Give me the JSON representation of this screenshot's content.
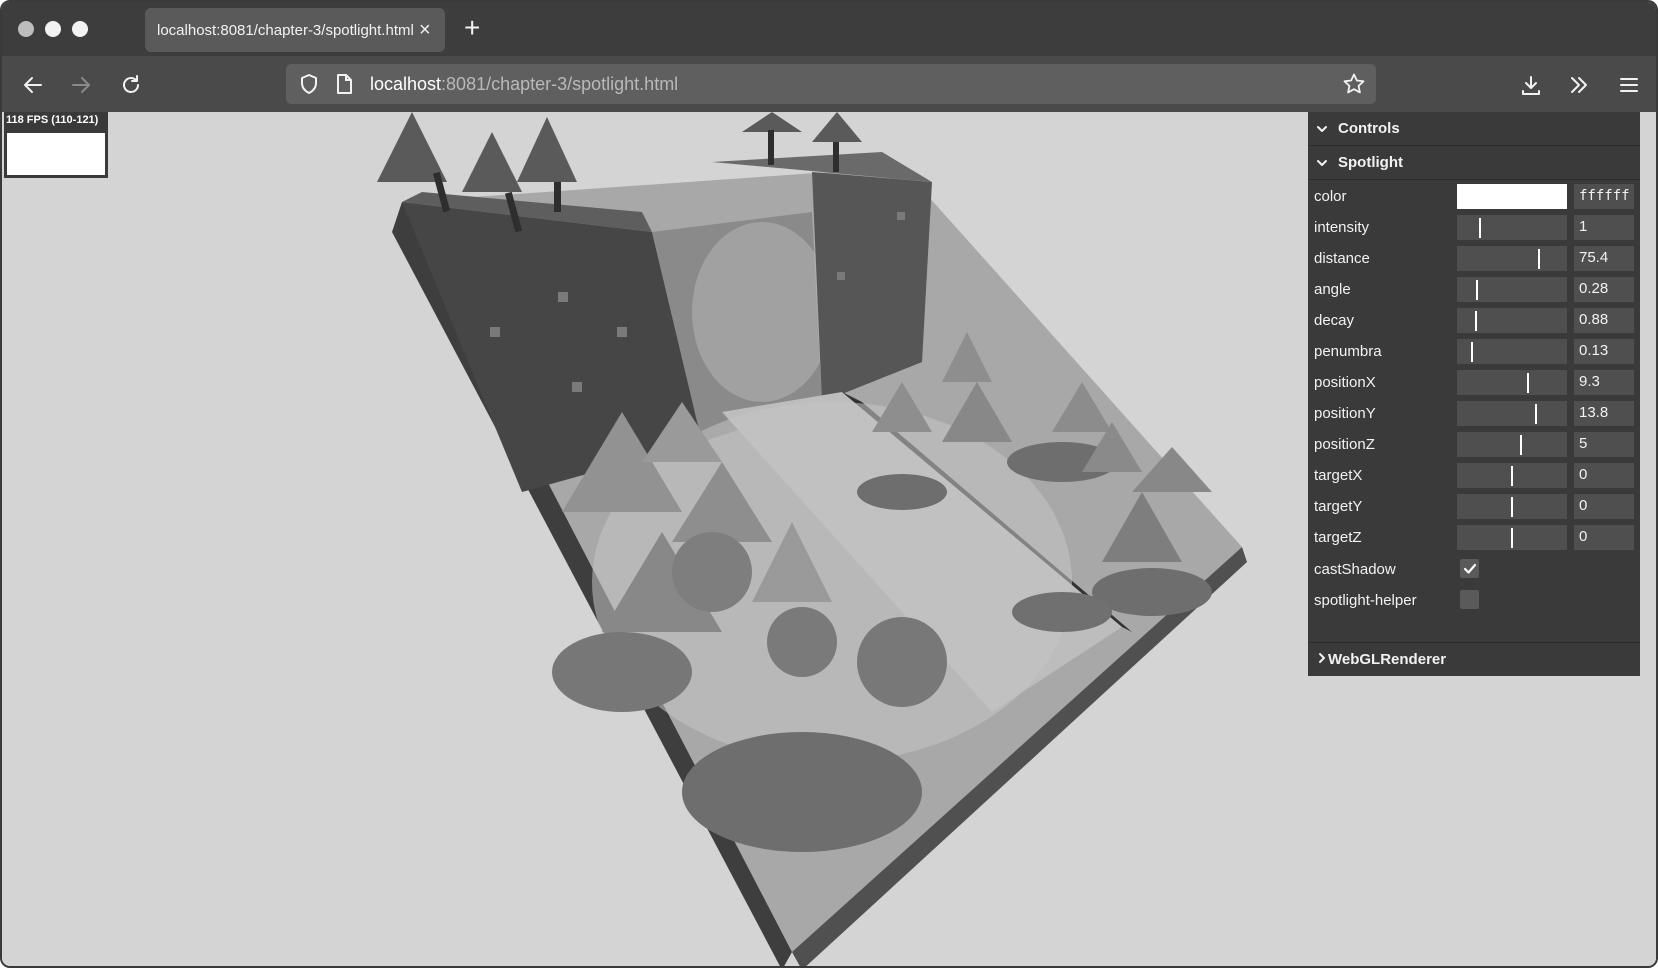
{
  "browser": {
    "tab_title": "localhost:8081/chapter-3/spotlight.html",
    "url_host": "localhost",
    "url_rest": ":8081/chapter-3/spotlight.html"
  },
  "stats": {
    "fps_text": "118 FPS (110-121)"
  },
  "gui": {
    "root_label": "Controls",
    "spotlight_label": "Spotlight",
    "color": {
      "label": "color",
      "value": "ffffff",
      "swatch": "#ffffff"
    },
    "sliders": [
      {
        "label": "intensity",
        "value": "1",
        "fraction": 0.2
      },
      {
        "label": "distance",
        "value": "75.4",
        "fraction": 0.75
      },
      {
        "label": "angle",
        "value": "0.28",
        "fraction": 0.18
      },
      {
        "label": "decay",
        "value": "0.88",
        "fraction": 0.17
      },
      {
        "label": "penumbra",
        "value": "0.13",
        "fraction": 0.13
      },
      {
        "label": "positionX",
        "value": "9.3",
        "fraction": 0.65
      },
      {
        "label": "positionY",
        "value": "13.8",
        "fraction": 0.72
      },
      {
        "label": "positionZ",
        "value": "5",
        "fraction": 0.58
      },
      {
        "label": "targetX",
        "value": "0",
        "fraction": 0.5
      },
      {
        "label": "targetY",
        "value": "0",
        "fraction": 0.5
      },
      {
        "label": "targetZ",
        "value": "0",
        "fraction": 0.5
      }
    ],
    "checkboxes": [
      {
        "label": "castShadow",
        "checked": true
      },
      {
        "label": "spotlight-helper",
        "checked": false
      }
    ],
    "webgl_label": "WebGLRenderer"
  }
}
